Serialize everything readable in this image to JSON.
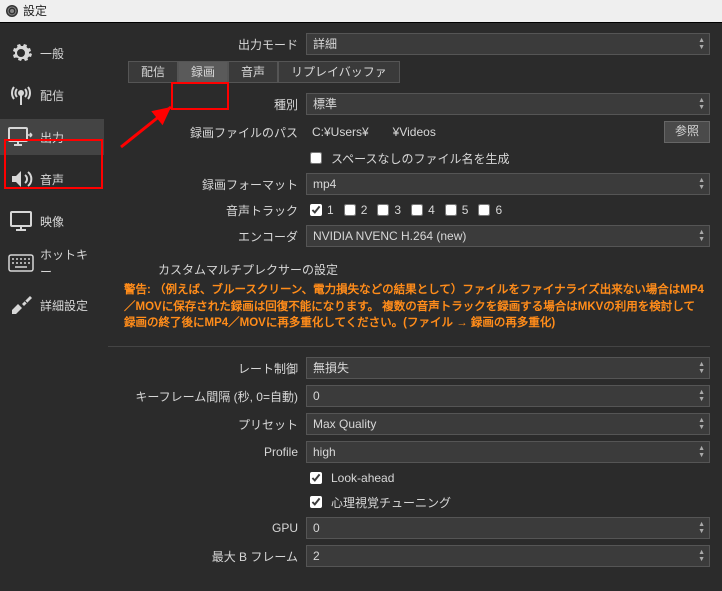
{
  "window": {
    "title": "設定"
  },
  "sidebar": {
    "items": [
      {
        "label": "一般"
      },
      {
        "label": "配信"
      },
      {
        "label": "出力"
      },
      {
        "label": "音声"
      },
      {
        "label": "映像"
      },
      {
        "label": "ホットキー"
      },
      {
        "label": "詳細設定"
      }
    ]
  },
  "output_mode": {
    "label": "出力モード",
    "value": "詳細"
  },
  "tabs": {
    "items": [
      {
        "label": "配信"
      },
      {
        "label": "録画"
      },
      {
        "label": "音声"
      },
      {
        "label": "リプレイバッファ"
      }
    ]
  },
  "recording": {
    "type_label": "種別",
    "type_value": "標準",
    "path_label": "録画ファイルのパス",
    "path_value": "C:¥Users¥　　¥Videos",
    "browse": "参照",
    "no_space_label": "スペースなしのファイル名を生成",
    "format_label": "録画フォーマット",
    "format_value": "mp4",
    "tracks_label": "音声トラック",
    "tracks": [
      "1",
      "2",
      "3",
      "4",
      "5",
      "6"
    ],
    "encoder_label": "エンコーダ",
    "encoder_value": "NVIDIA NVENC H.264 (new)",
    "mux_label": "カスタムマルチプレクサーの設定"
  },
  "warning": "警告: （例えば、ブルースクリーン、電力損失などの結果として）ファイルをファイナライズ出来ない場合はMP4／MOVに保存された録画は回復不能になります。 複数の音声トラックを録画する場合はMKVの利用を検討して録画の終了後にMP4／MOVに再多重化してください。(ファイル → 録画の再多重化)",
  "encoder": {
    "rate_label": "レート制御",
    "rate_value": "無損失",
    "keyint_label": "キーフレーム間隔 (秒, 0=自動)",
    "keyint_value": "0",
    "preset_label": "プリセット",
    "preset_value": "Max Quality",
    "profile_label": "Profile",
    "profile_value": "high",
    "lookahead_label": "Look-ahead",
    "psycho_label": "心理視覚チューニング",
    "gpu_label": "GPU",
    "gpu_value": "0",
    "bframes_label": "最大 B フレーム",
    "bframes_value": "2"
  }
}
